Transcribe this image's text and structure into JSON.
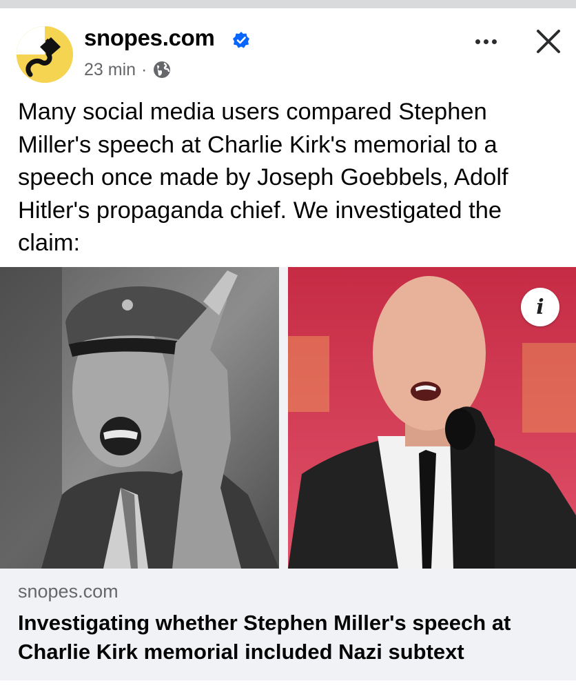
{
  "post": {
    "page_name": "snopes.com",
    "time": "23 min",
    "separator": "·",
    "text": "Many social media users compared Stephen Miller's speech at Charlie Kirk's memorial to a speech once made by Joseph Goebbels, Adolf Hitler's propaganda chief. We investigated the claim:"
  },
  "link_preview": {
    "domain": "snopes.com",
    "title": "Investigating whether Stephen Miller's speech at Charlie Kirk memorial included Nazi subtext"
  },
  "icons": {
    "verified": "verified-badge-icon",
    "audience": "globe-icon",
    "more": "more-options-icon",
    "close": "close-icon",
    "info": "info-icon"
  },
  "info_glyph": "i",
  "colors": {
    "verified_blue": "#0866ff",
    "secondary_text": "#65676b",
    "card_bg": "#f0f2f5",
    "logo_yellow": "#f4d451"
  }
}
